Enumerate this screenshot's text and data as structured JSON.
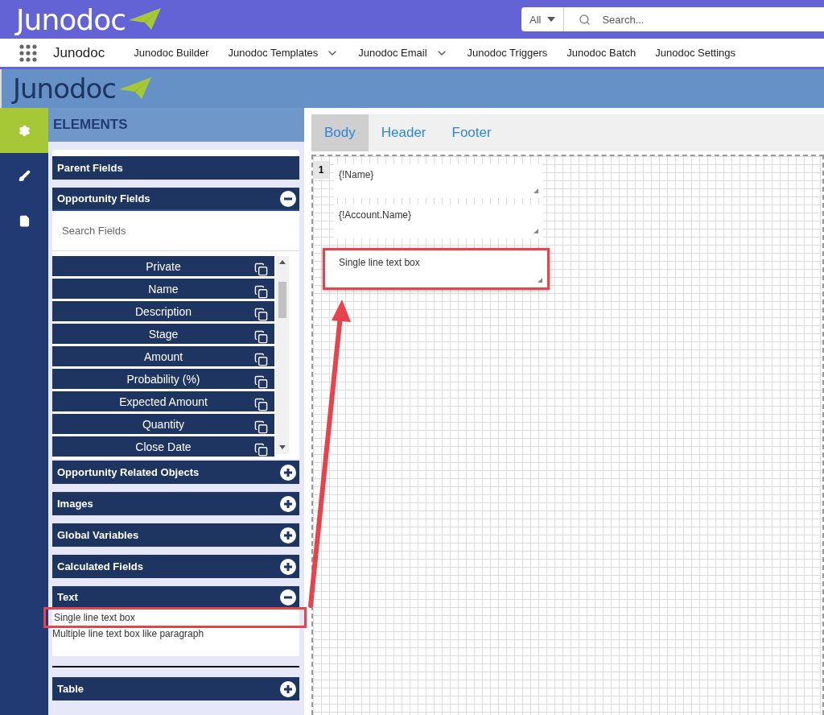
{
  "top_bar": {
    "logo": "Junodoc",
    "search_scope": "All",
    "search": {
      "placeholder": "Search..."
    }
  },
  "nav": {
    "app_name": "Junodoc",
    "items": [
      {
        "label": "Junodoc Builder",
        "has_menu": false
      },
      {
        "label": "Junodoc Templates",
        "has_menu": true
      },
      {
        "label": "Junodoc Email",
        "has_menu": true
      },
      {
        "label": "Junodoc Triggers",
        "has_menu": false
      },
      {
        "label": "Junodoc Batch",
        "has_menu": false
      },
      {
        "label": "Junodoc Settings",
        "has_menu": false
      }
    ]
  },
  "app_header": {
    "logo": "Junodoc"
  },
  "rail": [
    {
      "kind": "gear",
      "selected": true
    },
    {
      "kind": "brush",
      "selected": false
    },
    {
      "kind": "file",
      "selected": false
    }
  ],
  "panel": {
    "title": "ELEMENTS",
    "sections": [
      {
        "title": "Parent Fields",
        "kind": "plain",
        "expanded": false
      },
      {
        "title": "Opportunity Fields",
        "kind": "toggle",
        "expanded": true,
        "search": {
          "placeholder": "Search Fields"
        },
        "fields": [
          "Private",
          "Name",
          "Description",
          "Stage",
          "Amount",
          "Probability (%)",
          "Expected Amount",
          "Quantity",
          "Close Date"
        ]
      },
      {
        "title": "Opportunity Related Objects",
        "kind": "toggle",
        "expanded": false
      },
      {
        "title": "Images",
        "kind": "toggle",
        "expanded": false
      },
      {
        "title": "Global Variables",
        "kind": "toggle",
        "expanded": false
      },
      {
        "title": "Calculated Fields",
        "kind": "toggle",
        "expanded": false
      },
      {
        "title": "Text",
        "kind": "toggle",
        "expanded": true,
        "items": [
          {
            "label": "Single line text box",
            "highlighted": true
          },
          {
            "label": "Multiple line text box like paragraph",
            "highlighted": false
          }
        ]
      },
      {
        "title": "Table",
        "kind": "toggle",
        "expanded": false
      }
    ]
  },
  "canvas": {
    "tabs": [
      {
        "label": "Body",
        "selected": true
      },
      {
        "label": "Header",
        "selected": false
      },
      {
        "label": "Footer",
        "selected": false
      }
    ],
    "page_number": "1",
    "boxes": [
      {
        "text": "{!Name}",
        "highlighted": false
      },
      {
        "text": "{!Account.Name}",
        "highlighted": false
      },
      {
        "text": "Single line text box",
        "highlighted": true
      }
    ]
  }
}
